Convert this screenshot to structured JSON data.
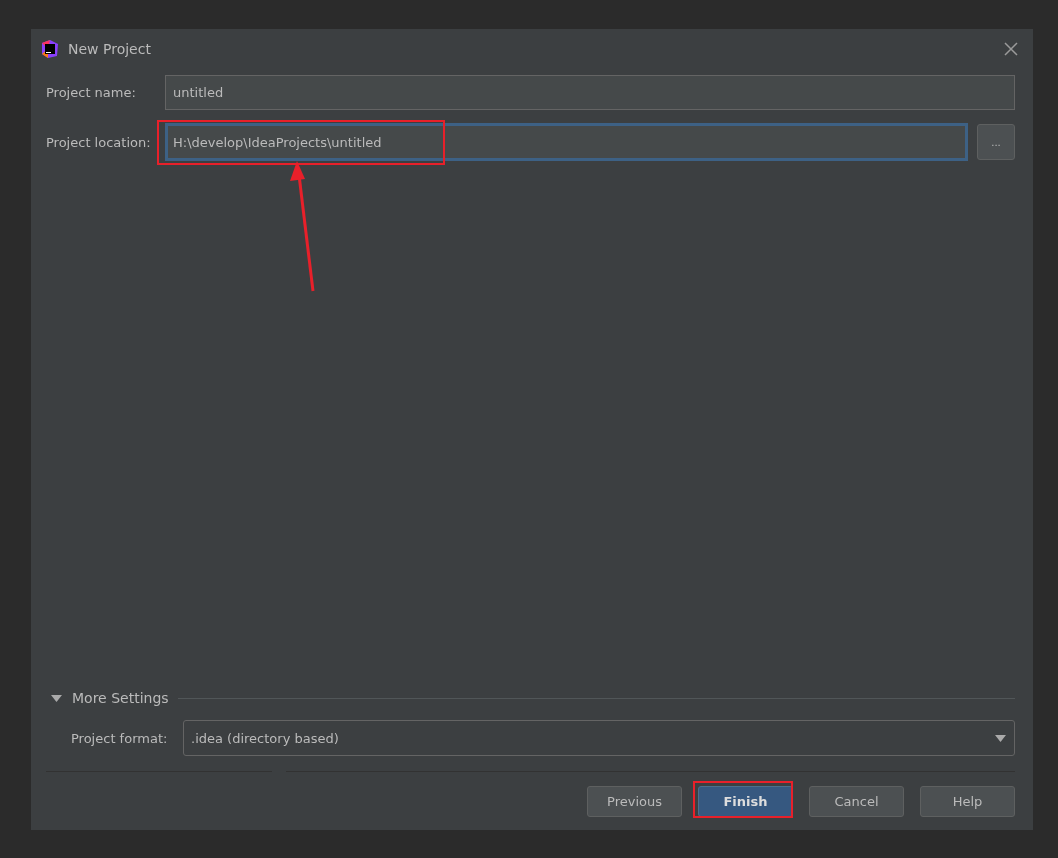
{
  "window": {
    "title": "New Project"
  },
  "fields": [
    {
      "label": "Project name:",
      "value": "untitled",
      "focused": false,
      "highlighted": false,
      "browse": false
    },
    {
      "label": "Project location:",
      "value": "H:\\develop\\IdeaProjects\\untitled",
      "focused": true,
      "highlighted": true,
      "arrow": true,
      "browse": true,
      "browse_label": "..."
    }
  ],
  "more_settings": {
    "title": "More Settings",
    "expanded": true,
    "format": {
      "label": "Project format:",
      "value": ".idea (directory based)"
    }
  },
  "buttons": [
    {
      "label": "Previous",
      "default": false,
      "highlighted": false
    },
    {
      "label": "Finish",
      "default": true,
      "highlighted": true
    },
    {
      "label": "Cancel",
      "default": false,
      "highlighted": false
    },
    {
      "label": "Help",
      "default": false,
      "highlighted": false
    }
  ]
}
